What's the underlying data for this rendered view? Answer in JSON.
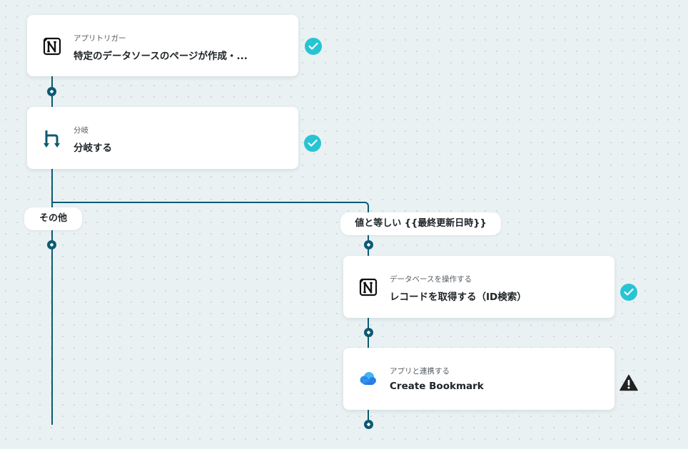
{
  "steps": [
    {
      "sub": "アプリトリガー",
      "main": "特定のデータソースのページが作成・...",
      "icon": "notion-icon",
      "status": "success"
    },
    {
      "sub": "分岐",
      "main": "分岐する",
      "icon": "branch-icon",
      "status": "success"
    },
    {
      "sub": "データベースを操作する",
      "main": "レコードを取得する（ID検索）",
      "icon": "notion-icon",
      "status": "success"
    },
    {
      "sub": "アプリと連携する",
      "main": "Create Bookmark",
      "icon": "cloud-app-icon",
      "status": "warning"
    }
  ],
  "branches": {
    "left_label": "その他",
    "right_label": "値と等しい {{最終更新日時}}"
  },
  "colors": {
    "connector": "#0d5a73",
    "success": "#27c4d3",
    "warning": "#222222",
    "background": "#eaf1f3"
  }
}
